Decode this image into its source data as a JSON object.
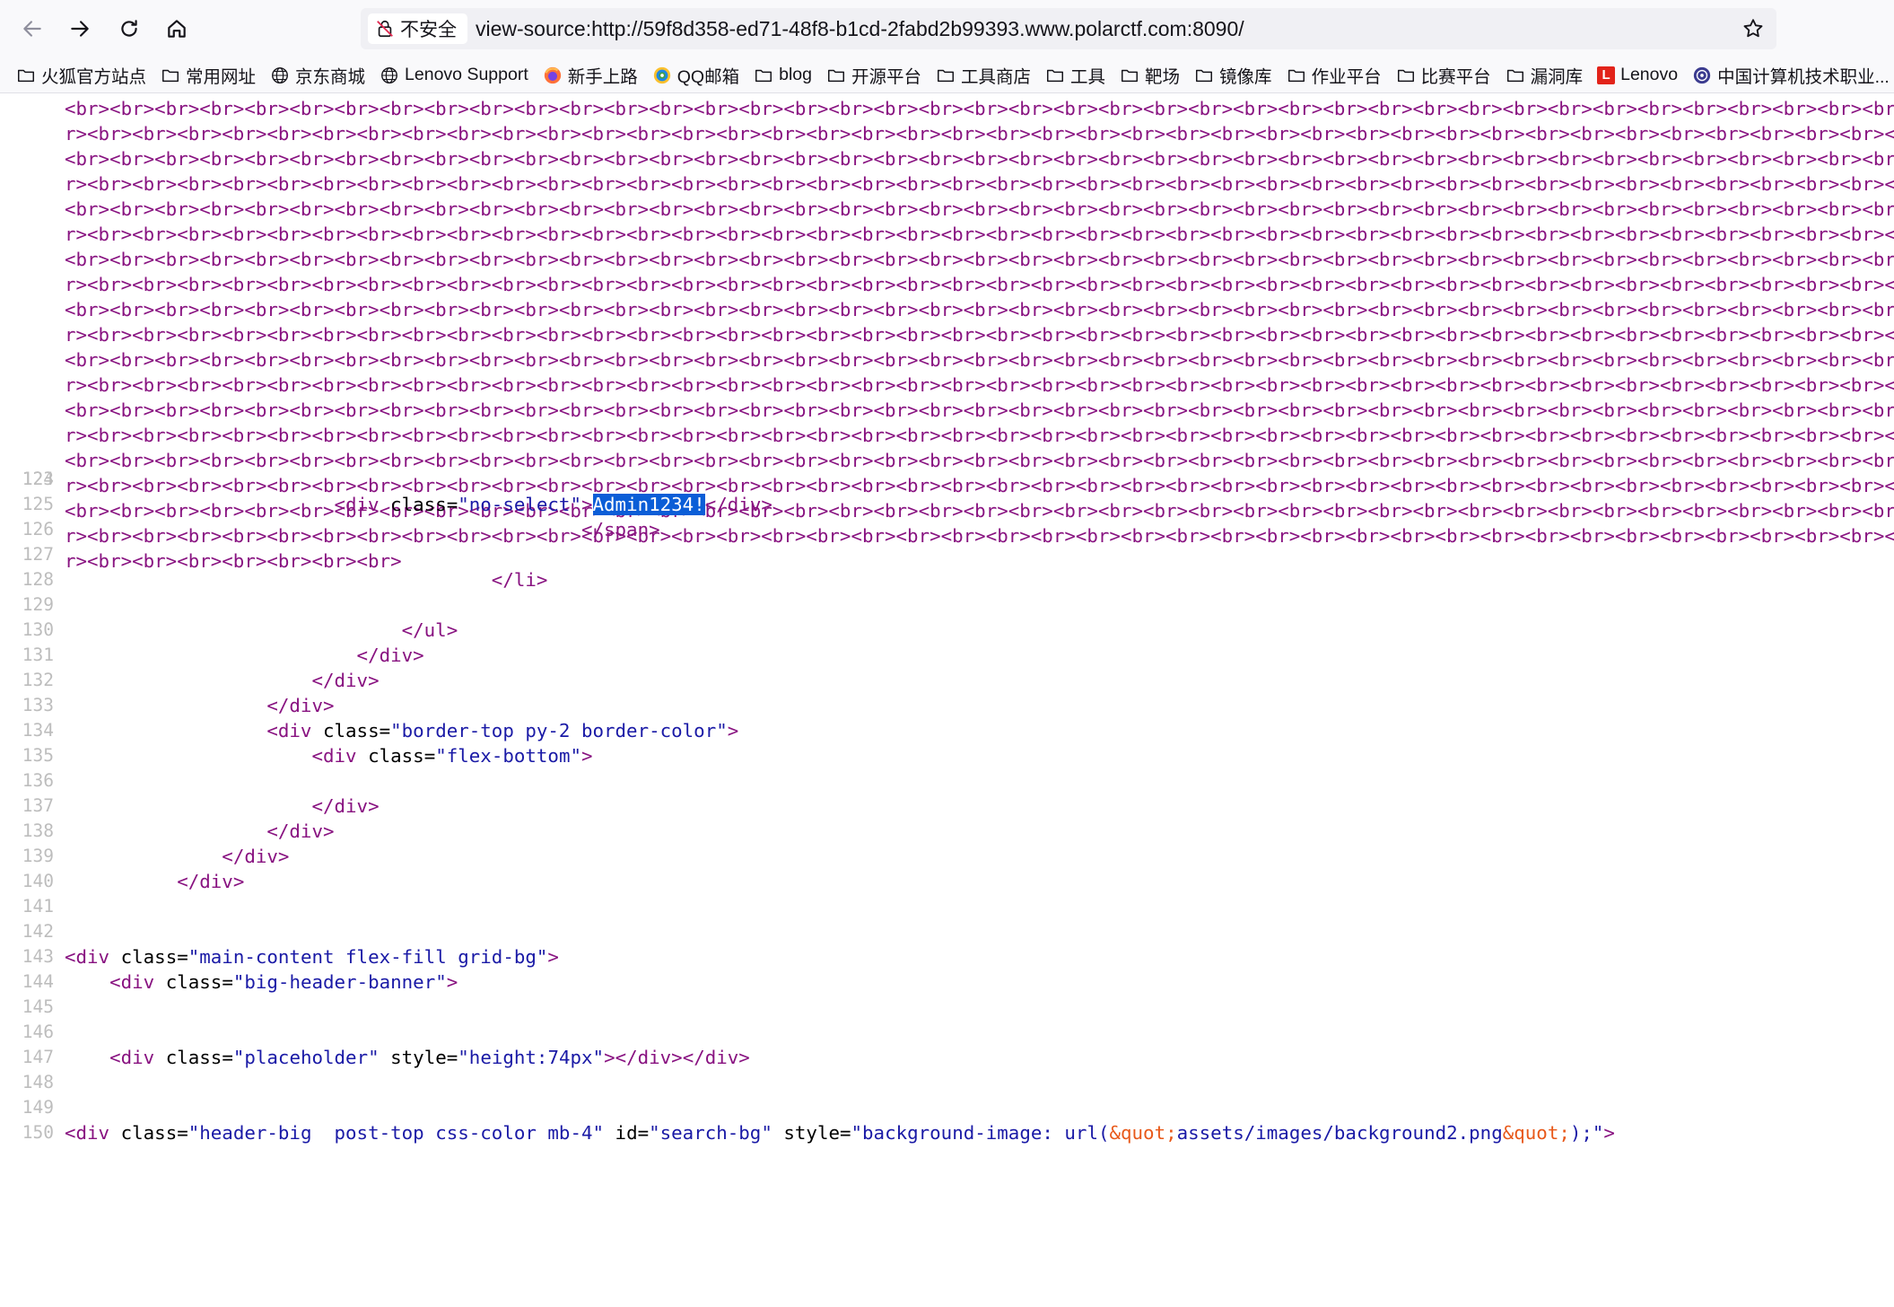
{
  "browser": {
    "security_label": "不安全",
    "url": "view-source:http://59f8d358-ed71-48f8-b1cd-2fabd2b99393.www.polarctf.com:8090/",
    "icons": [
      "back-icon",
      "forward-icon",
      "reload-icon",
      "home-icon",
      "insecure-lock-icon",
      "bookmark-star-icon"
    ]
  },
  "bookmarks": [
    {
      "label": "火狐官方站点",
      "icon": "folder-icon"
    },
    {
      "label": "常用网址",
      "icon": "folder-icon"
    },
    {
      "label": "京东商城",
      "icon": "globe-icon"
    },
    {
      "label": "Lenovo Support",
      "icon": "globe-icon"
    },
    {
      "label": "新手上路",
      "icon": "firefox-icon"
    },
    {
      "label": "QQ邮箱",
      "icon": "qq-mail-icon"
    },
    {
      "label": "blog",
      "icon": "folder-icon"
    },
    {
      "label": "开源平台",
      "icon": "folder-icon"
    },
    {
      "label": "工具商店",
      "icon": "folder-icon"
    },
    {
      "label": "工具",
      "icon": "folder-icon"
    },
    {
      "label": "靶场",
      "icon": "folder-icon"
    },
    {
      "label": "镜像库",
      "icon": "folder-icon"
    },
    {
      "label": "作业平台",
      "icon": "folder-icon"
    },
    {
      "label": "比赛平台",
      "icon": "folder-icon"
    },
    {
      "label": "漏洞库",
      "icon": "folder-icon"
    },
    {
      "label": "Lenovo",
      "icon": "lenovo-icon"
    },
    {
      "label": "中国计算机技术职业...",
      "icon": "cert-icon"
    }
  ],
  "source": {
    "br_rows": {
      "row_a": "<br><br><br><br><br><br><br><br><br><br><br><br><br><br><br><br><br><br><br><br><br><br><br><br><br><br><br><br><br><br><br><br><br><br><br><br><br><br><br><br><br><br><br><br><br><br><br><br><br><br><br><br>",
      "row_b": "r><br><br><br><br><br><br><br><br><br><br><br><br><br><br><br><br><br><br><br><br><br><br><br><br><br><br><br><br><br><br><br><br><br><br><br><br><br><br><br><br><br><br><br><br><br><br><br><br><br><br><br><br>",
      "last": "r><br><br><br><br><br><br><br>"
    },
    "line_123": {
      "num": "123",
      "indent": "                        ",
      "open_start": "<div ",
      "attr": "class",
      "eq": "=",
      "val": "\"no-select\"",
      "gt": ">",
      "selected": "Admin1234!",
      "close": "</div>"
    },
    "lines": [
      {
        "num": "124",
        "text": ""
      },
      {
        "num": "125",
        "text": ""
      },
      {
        "num": "126",
        "indent": "                                              ",
        "tag": "</span>"
      },
      {
        "num": "127",
        "text": ""
      },
      {
        "num": "128",
        "indent": "                                      ",
        "tag": "</li>"
      },
      {
        "num": "129",
        "text": ""
      },
      {
        "num": "130",
        "indent": "                              ",
        "tag": "</ul>"
      },
      {
        "num": "131",
        "indent": "                          ",
        "tag": "</div>"
      },
      {
        "num": "132",
        "indent": "                      ",
        "tag": "</div>"
      },
      {
        "num": "133",
        "indent": "                  ",
        "tag": "</div>"
      }
    ],
    "line_134": {
      "num": "134",
      "indent": "                  ",
      "open": "<div ",
      "attr": "class",
      "val": "\"border-top py-2 border-color\"",
      "gt": ">"
    },
    "line_135": {
      "num": "135",
      "indent": "                      ",
      "open": "<div ",
      "attr": "class",
      "val": "\"flex-bottom\"",
      "gt": ">"
    },
    "line_136": {
      "num": "136"
    },
    "line_137": {
      "num": "137",
      "indent": "                      ",
      "tag": "</div>"
    },
    "line_138": {
      "num": "138",
      "indent": "                  ",
      "tag": "</div>"
    },
    "line_139": {
      "num": "139",
      "indent": "              ",
      "tag": "</div>"
    },
    "line_140": {
      "num": "140",
      "indent": "          ",
      "tag": "</div>"
    },
    "line_141": {
      "num": "141"
    },
    "line_142": {
      "num": "142"
    },
    "line_143": {
      "num": "143",
      "open": "<div ",
      "attr": "class",
      "val": "\"main-content flex-fill grid-bg\"",
      "gt": ">"
    },
    "line_144": {
      "num": "144",
      "indent": "    ",
      "open": "<div ",
      "attr": "class",
      "val": "\"big-header-banner\"",
      "gt": ">"
    },
    "line_145": {
      "num": "145"
    },
    "line_146": {
      "num": "146"
    },
    "line_147": {
      "num": "147",
      "indent": "    ",
      "open": "<div ",
      "attr": "class",
      "val": "\"placeholder\"",
      "attr2": " style",
      "val2": "\"height:74px\"",
      "tail": "></div></div>"
    },
    "line_148": {
      "num": "148"
    },
    "line_149": {
      "num": "149"
    },
    "line_150": {
      "num": "150",
      "open": "<div ",
      "attr": "class",
      "val": "\"header-big  post-top css-color mb-4\"",
      "attr2": " id",
      "val2": "\"search-bg\"",
      "attr3": " style",
      "val3a": "\"background-image: url(",
      "ent1": "&quot;",
      "val3b": "assets/images/background2.png",
      "ent2": "&quot;",
      "val3c": ");\"",
      "gt": ">"
    }
  },
  "colors": {
    "tag": "#881280",
    "value": "#1a1aa6",
    "entity": "#e8591a",
    "selection": "#0b5ed7",
    "line_number": "#bdbdbd"
  }
}
